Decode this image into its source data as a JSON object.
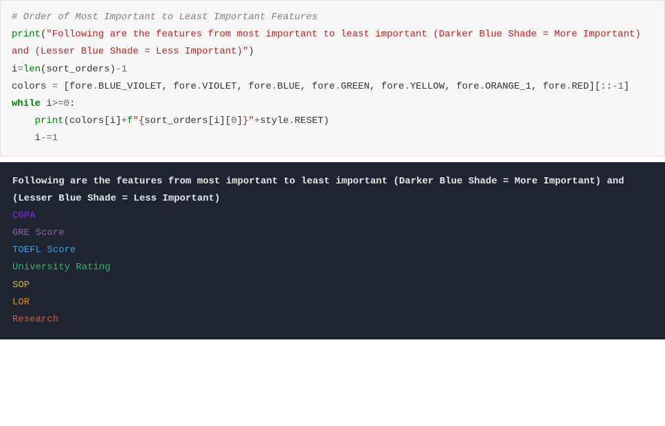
{
  "code": {
    "comment": "# Order of Most Important to Least Important Features",
    "print1_kw": "print",
    "print1_open": "(",
    "print1_q1": "\"",
    "print1_str": "Following are the features from most important to least important (Darker Blue Shade = More Important) and (Lesser Blue Shade = Less Important)",
    "print1_q2": "\"",
    "print1_close": ")",
    "line3_i": "i",
    "line3_eq": "=",
    "line3_len": "len",
    "line3_open": "(",
    "line3_arg": "sort_orders",
    "line3_close": ")",
    "line3_minus": "-",
    "line3_one": "1",
    "line4_colors": "colors ",
    "line4_eq": "=",
    "line4_listopen": " [",
    "line4_item1": "fore",
    "line4_dot1": ".",
    "line4_attr1": "BLUE_VIOLET",
    "line4_c1": ", ",
    "line4_item2": "fore",
    "line4_dot2": ".",
    "line4_attr2": "VIOLET",
    "line4_c2": ", ",
    "line4_item3": "fore",
    "line4_dot3": ".",
    "line4_attr3": "BLUE",
    "line4_c3": ", ",
    "line4_item4": "fore",
    "line4_dot4": ".",
    "line4_attr4": "GREEN",
    "line4_c4": ", ",
    "line4_item5": "fore",
    "line4_dot5": ".",
    "line4_attr5": "YELLOW",
    "line4_c5": ", ",
    "line4_item6": "fore",
    "line4_dot6": ".",
    "line4_attr6": "ORANGE_1",
    "line4_c6": ", ",
    "line4_item7": "fore",
    "line4_dot7": ".",
    "line4_attr7": "RED",
    "line4_listclose": "][",
    "line4_slice": "::",
    "line4_neg": "-",
    "line4_one": "1",
    "line4_bracket": "]",
    "line5_while": "while",
    "line5_cond_i": " i",
    "line5_cond_op": ">=",
    "line5_cond_zero": "0",
    "line5_colon": ":",
    "line6_indent": "    ",
    "line6_print": "print",
    "line6_open": "(",
    "line6_colors": "colors[i]",
    "line6_plus1": "+",
    "line6_fprefix": "f",
    "line6_fq1": "\"",
    "line6_brace_open": "{",
    "line6_expr": "sort_orders[i][",
    "line6_zero": "0",
    "line6_expr2": "]",
    "line6_brace_close": "}",
    "line6_fq2": "\"",
    "line6_plus2": "+",
    "line6_style": "style",
    "line6_dot": ".",
    "line6_reset": "RESET",
    "line6_close": ")",
    "line7_indent": "    ",
    "line7_i": "i",
    "line7_op": "-=",
    "line7_one": "1"
  },
  "output": {
    "header": "Following are the features from most important to least important (Darker Blue Shade = More Important) and (Lesser Blue Shade = Less Important)",
    "lines": {
      "l1": "CGPA",
      "l2": "GRE Score",
      "l2_tok1": "GRE ",
      "l2_tok2": "Score",
      "l3": "TOEFL Score",
      "l3_tok1": "TOEFL ",
      "l3_tok2": "Score",
      "l4": "University Rating",
      "l5": "SOP",
      "l6": "LOR",
      "l7": "Research"
    }
  }
}
